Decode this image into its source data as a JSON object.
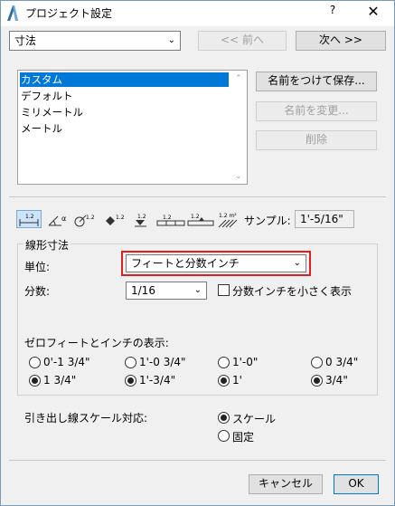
{
  "window": {
    "title": "プロジェクト設定",
    "help": "?",
    "close": "✕"
  },
  "top": {
    "category": "寸法",
    "prev": "<< 前へ",
    "next": "次へ >>"
  },
  "presets": {
    "items": [
      "カスタム",
      "デフォルト",
      "ミリメートル",
      "メートル"
    ],
    "selected_index": 0
  },
  "preset_buttons": {
    "save_as": "名前をつけて保存...",
    "rename": "名前を変更...",
    "delete": "削除"
  },
  "toolbar": {
    "tools": [
      {
        "icon": "linear-dimension-icon",
        "label": "1.2"
      },
      {
        "icon": "angle-dimension-icon",
        "label": "α"
      },
      {
        "icon": "radial-dimension-icon",
        "label": "1.2"
      },
      {
        "icon": "level-dimension-icon",
        "label": "1.2"
      },
      {
        "icon": "elevation-dimension-icon",
        "label": "1.2"
      },
      {
        "icon": "door-window-dimension-icon",
        "label": "1.2"
      },
      {
        "icon": "sill-height-icon",
        "label": "1.2"
      },
      {
        "icon": "area-calculation-icon",
        "label": "1.2 m²"
      }
    ],
    "sample_label": "サンプル:",
    "sample_value": "1'-5/16\""
  },
  "linear": {
    "group_title": "線形寸法",
    "unit_label": "単位:",
    "unit_value": "フィートと分数インチ",
    "fraction_label": "分数:",
    "fraction_value": "1/16",
    "small_inch_label": "分数インチを小さく表示",
    "small_inch_checked": false
  },
  "zero_feet": {
    "title": "ゼロフィートとインチの表示:",
    "options": [
      "0'-1 3/4\"",
      "1'-0 3/4\"",
      "1'-0\"",
      "0 3/4\"",
      "1 3/4\"",
      "1'-3/4\"",
      "1'",
      "3/4\""
    ],
    "selected": [
      "1 3/4\"",
      "1'",
      "3/4\""
    ]
  },
  "leader_scale": {
    "label": "引き出し線スケール対応:",
    "options": [
      "スケール",
      "固定"
    ],
    "selected": "スケール"
  },
  "footer": {
    "cancel": "キャンセル",
    "ok": "OK"
  }
}
